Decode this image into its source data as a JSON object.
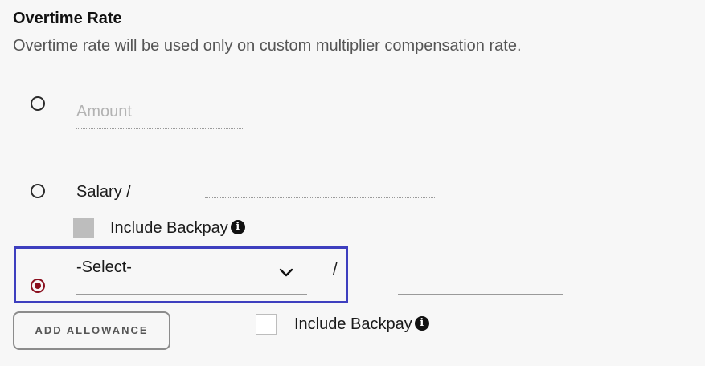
{
  "section": {
    "title": "Overtime Rate",
    "description": "Overtime rate will be used only on custom multiplier compensation rate."
  },
  "options": {
    "amount": {
      "placeholder": "Amount",
      "value": "",
      "selected": false
    },
    "salary": {
      "label": "Salary /",
      "value": "",
      "selected": false,
      "include_backpay": {
        "label": "Include Backpay",
        "checked": false,
        "disabled": true
      }
    },
    "allowance": {
      "selected": true,
      "select_value": "-Select-",
      "separator": "/",
      "value": "",
      "include_backpay": {
        "label": "Include Backpay",
        "checked": false,
        "disabled": false
      }
    }
  },
  "buttons": {
    "add_allowance": "ADD ALLOWANCE"
  },
  "icons": {
    "info": "info-circle-icon",
    "dropdown": "chevron-down-icon"
  },
  "colors": {
    "radio_selected": "#8a0f1e",
    "highlight_border": "#3e3fbf",
    "disabled_checkbox": "#bdbdbd"
  }
}
